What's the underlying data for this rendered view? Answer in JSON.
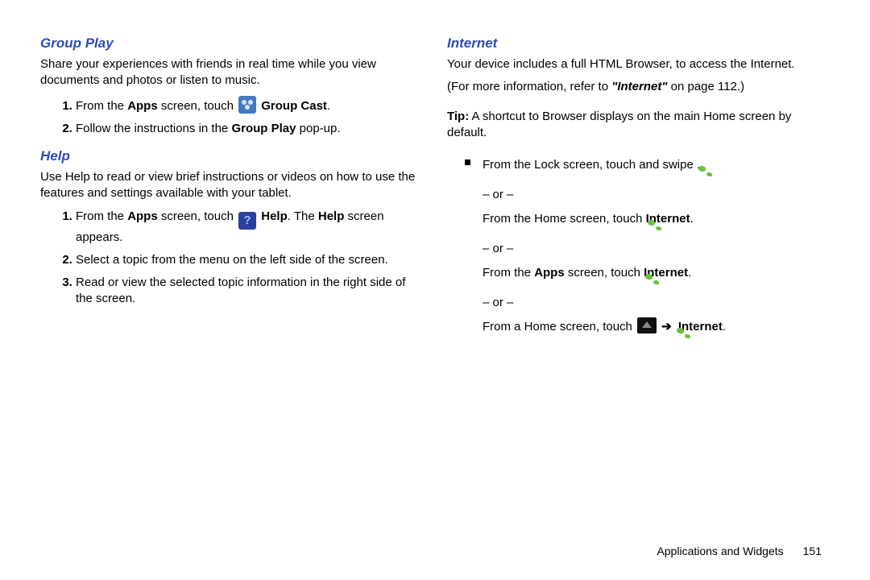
{
  "left": {
    "groupPlay": {
      "heading": "Group Play",
      "intro": "Share your experiences with friends in real time while you view documents and photos or listen to music.",
      "step1_a": "From the ",
      "step1_b": "Apps",
      "step1_c": " screen, touch ",
      "step1_d": "Group Cast",
      "step1_e": ".",
      "step2_a": "Follow the instructions in the ",
      "step2_b": "Group Play",
      "step2_c": " pop-up."
    },
    "help": {
      "heading": "Help",
      "intro": "Use Help to read or view brief instructions or videos on how to use the features and settings available with your tablet.",
      "step1_a": "From the ",
      "step1_b": "Apps",
      "step1_c": " screen, touch ",
      "step1_d": "Help",
      "step1_e": ". The ",
      "step1_f": "Help",
      "step1_g": " screen appears.",
      "step2": "Select a topic from the menu on the left side of the screen.",
      "step3": "Read or view the selected topic information in the right side of the screen."
    }
  },
  "right": {
    "internet": {
      "heading": "Internet",
      "intro": "Your device includes a full HTML Browser, to access the Internet.",
      "ref_a": "(For more information, refer to ",
      "ref_b": "\"Internet\"",
      "ref_c": " on page 112.)",
      "tip_label": "Tip:",
      "tip_text": " A shortcut to Browser displays on the main Home screen by default.",
      "b1_a": "From the Lock screen, touch and swipe ",
      "b1_b": ".",
      "or": "– or –",
      "b2_a": "From the Home screen, touch ",
      "b2_b": "Internet",
      "b2_c": ".",
      "b3_a": "From the ",
      "b3_b": "Apps",
      "b3_c": " screen, touch ",
      "b3_d": "Internet",
      "b3_e": ".",
      "b4_a": "From a Home screen, touch ",
      "b4_arrow": "➔",
      "b4_b": "Internet",
      "b4_c": "."
    }
  },
  "footer": {
    "section": "Applications and Widgets",
    "page": "151"
  }
}
